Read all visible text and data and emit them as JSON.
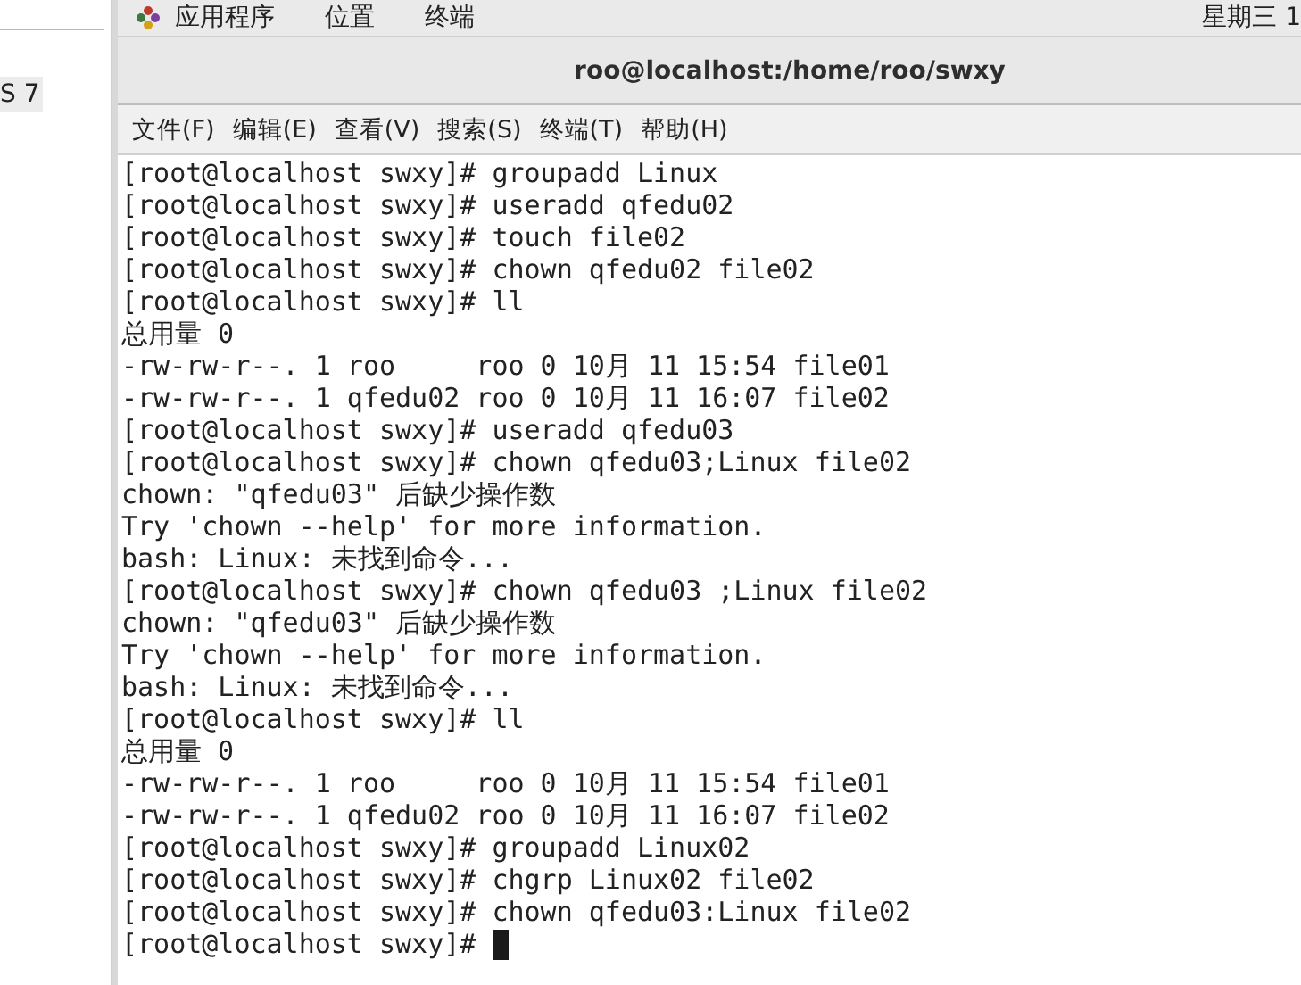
{
  "top_bar": {
    "menus": [
      "应用程序",
      "位置",
      "终端"
    ],
    "clock": "星期三 1"
  },
  "side_panel": {
    "label": "S 7"
  },
  "window": {
    "title": "roo@localhost:/home/roo/swxy"
  },
  "menu_bar": [
    "文件(F)",
    "编辑(E)",
    "查看(V)",
    "搜索(S)",
    "终端(T)",
    "帮助(H)"
  ],
  "terminal": {
    "lines": [
      "[root@localhost swxy]# groupadd Linux",
      "[root@localhost swxy]# useradd qfedu02",
      "[root@localhost swxy]# touch file02",
      "[root@localhost swxy]# chown qfedu02 file02",
      "[root@localhost swxy]# ll",
      "总用量 0",
      "-rw-rw-r--. 1 roo     roo 0 10月 11 15:54 file01",
      "-rw-rw-r--. 1 qfedu02 roo 0 10月 11 16:07 file02",
      "[root@localhost swxy]# useradd qfedu03",
      "[root@localhost swxy]# chown qfedu03;Linux file02",
      "chown: \"qfedu03\" 后缺少操作数",
      "Try 'chown --help' for more information.",
      "bash: Linux: 未找到命令...",
      "[root@localhost swxy]# chown qfedu03 ;Linux file02",
      "chown: \"qfedu03\" 后缺少操作数",
      "Try 'chown --help' for more information.",
      "bash: Linux: 未找到命令...",
      "[root@localhost swxy]# ll",
      "总用量 0",
      "-rw-rw-r--. 1 roo     roo 0 10月 11 15:54 file01",
      "-rw-rw-r--. 1 qfedu02 roo 0 10月 11 16:07 file02",
      "[root@localhost swxy]# groupadd Linux02",
      "[root@localhost swxy]# chgrp Linux02 file02",
      "[root@localhost swxy]# chown qfedu03:Linux file02",
      "[root@localhost swxy]# "
    ],
    "cursor": true
  }
}
